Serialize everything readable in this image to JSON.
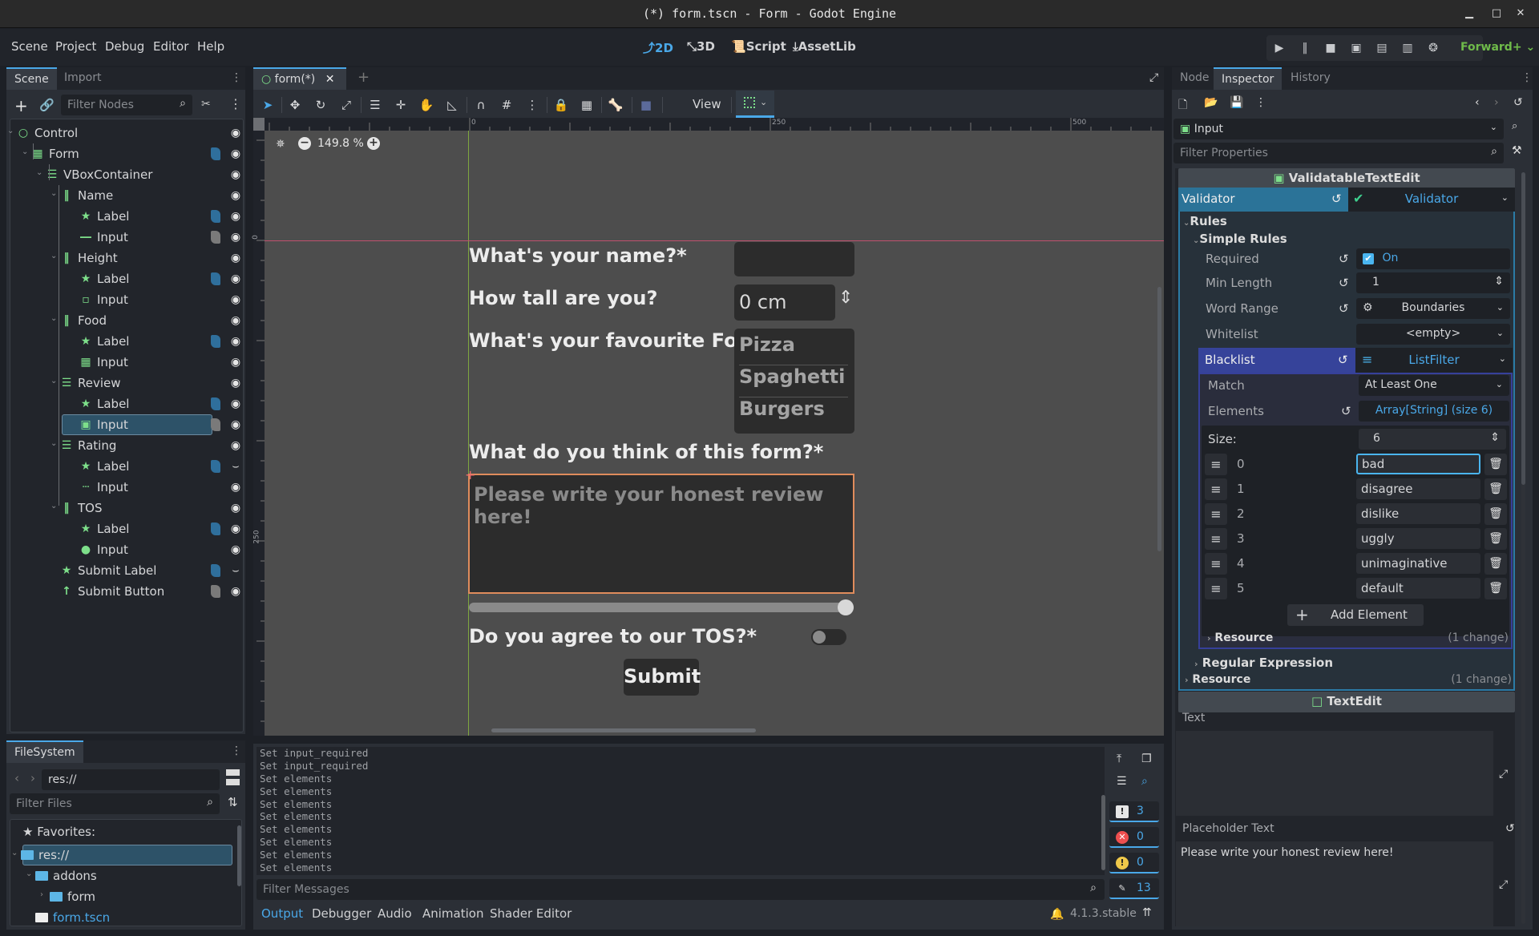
{
  "window": {
    "title": "(*) form.tscn - Form - Godot Engine",
    "controls": [
      "minimize",
      "maximize",
      "close"
    ]
  },
  "menubar": {
    "menus": [
      "Scene",
      "Project",
      "Debug",
      "Editor",
      "Help"
    ],
    "modes": [
      {
        "label": "2D",
        "icon": "2d-icon",
        "active": true
      },
      {
        "label": "3D",
        "icon": "3d-icon",
        "active": false
      },
      {
        "label": "Script",
        "icon": "script-icon",
        "active": false
      },
      {
        "label": "AssetLib",
        "icon": "download-icon",
        "active": false
      }
    ],
    "run_buttons": [
      "play",
      "pause",
      "stop",
      "remote-debug",
      "play-scene",
      "play-custom",
      "movie-maker"
    ],
    "renderer": "Forward+"
  },
  "scene_dock": {
    "tabs": [
      "Scene",
      "Import"
    ],
    "active_tab": "Scene",
    "filter_placeholder": "Filter Nodes",
    "tree": [
      {
        "name": "Control",
        "type": "control",
        "depth": 0,
        "script": null,
        "visible": true
      },
      {
        "name": "Form",
        "type": "grid",
        "depth": 1,
        "script": "blue",
        "visible": true
      },
      {
        "name": "VBoxContainer",
        "type": "vbox",
        "depth": 2,
        "script": null,
        "visible": true
      },
      {
        "name": "Name",
        "type": "hbox",
        "depth": 3,
        "script": null,
        "visible": true
      },
      {
        "name": "Label",
        "type": "label",
        "depth": 4,
        "script": "blue",
        "visible": true
      },
      {
        "name": "Input",
        "type": "lineedit",
        "depth": 4,
        "script": "gray",
        "visible": true
      },
      {
        "name": "Height",
        "type": "hbox",
        "depth": 3,
        "script": null,
        "visible": true
      },
      {
        "name": "Label",
        "type": "label",
        "depth": 4,
        "script": "blue",
        "visible": true
      },
      {
        "name": "Input",
        "type": "spinbox",
        "depth": 4,
        "script": null,
        "visible": true
      },
      {
        "name": "Food",
        "type": "hbox",
        "depth": 3,
        "script": null,
        "visible": true
      },
      {
        "name": "Label",
        "type": "label",
        "depth": 4,
        "script": "blue",
        "visible": true
      },
      {
        "name": "Input",
        "type": "itemlist",
        "depth": 4,
        "script": null,
        "visible": true
      },
      {
        "name": "Review",
        "type": "vbox",
        "depth": 3,
        "script": null,
        "visible": true
      },
      {
        "name": "Label",
        "type": "label",
        "depth": 4,
        "script": "blue",
        "visible": true
      },
      {
        "name": "Input",
        "type": "textedit",
        "depth": 4,
        "script": "gray",
        "visible": true,
        "selected": true
      },
      {
        "name": "Rating",
        "type": "vbox",
        "depth": 3,
        "script": null,
        "visible": true
      },
      {
        "name": "Label",
        "type": "label",
        "depth": 4,
        "script": "blue",
        "visible": false
      },
      {
        "name": "Input",
        "type": "slider",
        "depth": 4,
        "script": null,
        "visible": true
      },
      {
        "name": "TOS",
        "type": "hbox",
        "depth": 3,
        "script": null,
        "visible": true
      },
      {
        "name": "Label",
        "type": "label",
        "depth": 4,
        "script": "blue",
        "visible": true
      },
      {
        "name": "Input",
        "type": "toggle",
        "depth": 4,
        "script": null,
        "visible": true
      },
      {
        "name": "Submit Label",
        "type": "label",
        "depth": 3,
        "script": "blue",
        "visible": false
      },
      {
        "name": "Submit Button",
        "type": "button",
        "depth": 3,
        "script": "gray",
        "visible": true
      }
    ]
  },
  "filesystem": {
    "tab": "FileSystem",
    "path": "res://",
    "filter_placeholder": "Filter Files",
    "favorites_label": "Favorites:",
    "items": [
      {
        "name": "res://",
        "kind": "folder",
        "depth": 0,
        "selected": true
      },
      {
        "name": "addons",
        "kind": "folder",
        "depth": 1
      },
      {
        "name": "form",
        "kind": "folder",
        "depth": 2
      },
      {
        "name": "form.tscn",
        "kind": "scene",
        "depth": 1
      }
    ]
  },
  "viewport": {
    "tab_label": "form(*)",
    "view_menu": "View",
    "zoom": "149.8 %",
    "ruler_h_labels": [
      "0",
      "250",
      "500"
    ],
    "ruler_v_labels": [
      "0",
      "250"
    ],
    "form": {
      "name_label": "What's your name?*",
      "name_value": "",
      "height_label": "How tall are you?",
      "height_value": "0 cm",
      "food_label": "What's your favourite Food?",
      "food_options": [
        "Pizza",
        "Spaghetti",
        "Burgers"
      ],
      "review_label": "What do you think of this form?*",
      "review_placeholder": "Please write your honest review here!",
      "rating_value": 1.0,
      "tos_label": "Do you agree to our TOS?*",
      "tos_on": false,
      "submit_label": "Submit"
    }
  },
  "output": {
    "lines": [
      "Set input_required",
      "Set input_required",
      "Set elements",
      "Set elements",
      "Set elements",
      "Set elements",
      "Set elements",
      "Set elements",
      "Set elements",
      "Set elements"
    ],
    "filter_placeholder": "Filter Messages",
    "counts": {
      "messages": "3",
      "errors": "0",
      "warnings": "0",
      "editor": "13"
    },
    "tabs": [
      "Output",
      "Debugger",
      "Audio",
      "Animation",
      "Shader Editor"
    ],
    "active_tab": "Output",
    "version": "4.1.3.stable"
  },
  "inspector": {
    "tabs": [
      "Node",
      "Inspector",
      "History"
    ],
    "active_tab": "Inspector",
    "object": "Input",
    "filter_placeholder": "Filter Properties",
    "class_header": "ValidatableTextEdit",
    "validator": {
      "label": "Validator",
      "value": "Validator"
    },
    "rules_label": "Rules",
    "simple_rules_label": "Simple Rules",
    "props": {
      "required": {
        "label": "Required",
        "value": "On",
        "checked": true
      },
      "min_length": {
        "label": "Min Length",
        "value": "1"
      },
      "word_range": {
        "label": "Word Range",
        "value": "Boundaries"
      },
      "whitelist": {
        "label": "Whitelist",
        "value": "<empty>"
      },
      "blacklist": {
        "label": "Blacklist",
        "value": "ListFilter"
      },
      "match": {
        "label": "Match",
        "value": "At Least One"
      },
      "elements": {
        "label": "Elements",
        "value": "Array[String] (size 6)"
      },
      "size": {
        "label": "Size:",
        "value": "6"
      }
    },
    "array_items": [
      "bad",
      "disagree",
      "dislike",
      "uggly",
      "unimaginative",
      "default"
    ],
    "add_element": "Add Element",
    "resource_label": "Resource",
    "resource_changes": "(1 change)",
    "regex_label": "Regular Expression",
    "outer_resource_label": "Resource",
    "outer_resource_changes": "(1 change)",
    "textedit_header": "TextEdit",
    "text_label": "Text",
    "text_value": "",
    "placeholder_label": "Placeholder Text",
    "placeholder_value": "Please write your honest review here!"
  }
}
